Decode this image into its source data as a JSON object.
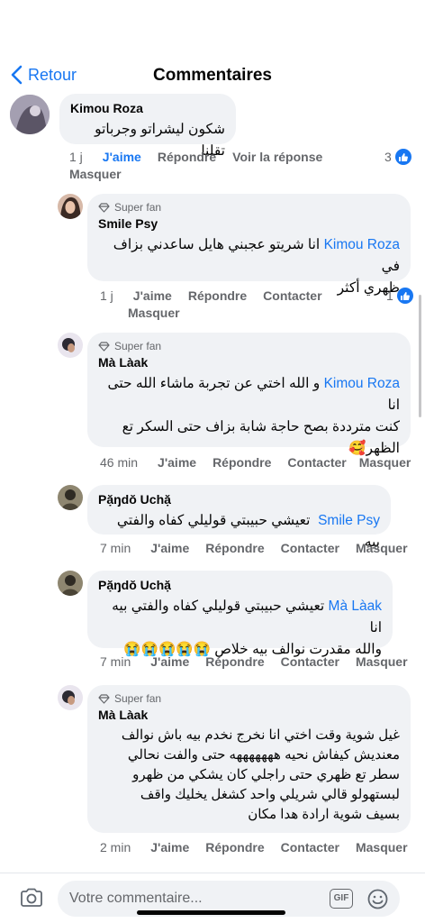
{
  "header": {
    "back_label": "Retour",
    "title": "Commentaires"
  },
  "comments": [
    {
      "author": "Kimou Roza",
      "text": "شكون ليشراتو وجرباتو تقلنا",
      "time": "1 j",
      "like": "J'aime",
      "reply": "Répondre",
      "see_reply": "Voir la réponse",
      "hide": "Masquer",
      "likes_count": "3"
    },
    {
      "badge": "Super fan",
      "author": "Smile Psy",
      "mention": "Kimou Roza",
      "text_line1": "انا شريتو عجبني هايل ساعدني بزاف في",
      "text_line2": "ظهري أكثر",
      "time": "1 j",
      "like": "J'aime",
      "reply": "Répondre",
      "contact": "Contacter",
      "hide": "Masquer",
      "likes_count": "1"
    },
    {
      "badge": "Super fan",
      "author": "Mà Làak",
      "mention": "Kimou Roza",
      "text_line1": "و الله اختي عن تجربة ماشاء الله حتى انا",
      "text_line2": "كنت مترددة بصح حاجة شابة بزاف حتى السكر تع",
      "text_line3": "الظهر🥰",
      "time": "46 min",
      "like": "J'aime",
      "reply": "Répondre",
      "contact": "Contacter",
      "hide": "Masquer"
    },
    {
      "author": "Pặŋdŏ Uchặ",
      "mention": "Smile Psy",
      "text": "تعيشي حبيبتي قوليلي كفاه والفتي بيه",
      "time": "7 min",
      "like": "J'aime",
      "reply": "Répondre",
      "contact": "Contacter",
      "hide": "Masquer"
    },
    {
      "author": "Pặŋdŏ Uchặ",
      "mention": "Mà Làak",
      "text_line1": "تعيشي حبيبتي قوليلي كفاه والفتي بيه انا",
      "text_line2": "والله مقدرت نوالف بيه خلاص 😭😭😭😭😭",
      "time": "7 min",
      "like": "J'aime",
      "reply": "Répondre",
      "contact": "Contacter",
      "hide": "Masquer"
    },
    {
      "badge": "Super fan",
      "author": "Mà Làak",
      "text_lines": [
        "غيل شوية وقت اختي انا نخرج نخدم بيه باش نوالف",
        "معنديش كيفاش نحيه هههههههه حتى والفت نحالي",
        "سطر تع ظهري حتى راجلي كان يشكي من ظهرو",
        "لبستهولو قالي شريلي واحد كشغل يخليك واقف",
        "بسيف شوية ارادة هدا مكان"
      ],
      "time": "2 min",
      "like": "J'aime",
      "reply": "Répondre",
      "contact": "Contacter",
      "hide": "Masquer"
    }
  ],
  "composer": {
    "placeholder": "Votre commentaire...",
    "gif_label": "GIF"
  }
}
